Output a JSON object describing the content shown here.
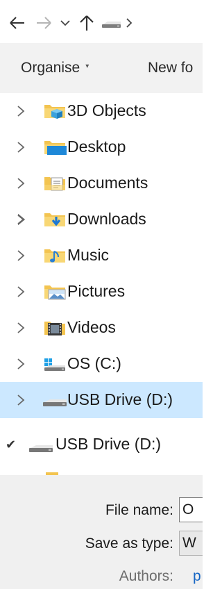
{
  "nav": {
    "back_icon": "arrow-left-icon",
    "forward_icon": "arrow-right-icon",
    "recent_icon": "chevron-down-icon",
    "up_icon": "arrow-up-icon",
    "drive_icon": "usb-drive-icon",
    "breadcrumb_icon": "chevron-right-icon"
  },
  "toolbar": {
    "organise_label": "Organise",
    "organise_caret": "▾",
    "new_folder_label": "New fo"
  },
  "tree": {
    "items": [
      {
        "label": "3D Objects",
        "icon": "3d-objects-folder-icon"
      },
      {
        "label": "Desktop",
        "icon": "desktop-folder-icon"
      },
      {
        "label": "Documents",
        "icon": "documents-folder-icon"
      },
      {
        "label": "Downloads",
        "icon": "downloads-folder-icon"
      },
      {
        "label": "Music",
        "icon": "music-folder-icon"
      },
      {
        "label": "Pictures",
        "icon": "pictures-folder-icon"
      },
      {
        "label": "Videos",
        "icon": "videos-folder-icon"
      },
      {
        "label": "OS (C:)",
        "icon": "windows-drive-icon"
      },
      {
        "label": "USB Drive (D:)",
        "icon": "usb-drive-icon",
        "selected": true
      }
    ]
  },
  "location": {
    "check": "✔",
    "label": "USB Drive (D:)",
    "icon": "usb-drive-icon"
  },
  "form": {
    "file_name_label": "File name:",
    "file_name_value": "O",
    "save_type_label": "Save as type:",
    "save_type_value": "W",
    "authors_label": "Authors:",
    "authors_value": "p"
  },
  "colors": {
    "selection": "#cce8ff",
    "command_bar": "#f2f2f2",
    "folder": "#f3c450",
    "link": "#1666c4"
  }
}
